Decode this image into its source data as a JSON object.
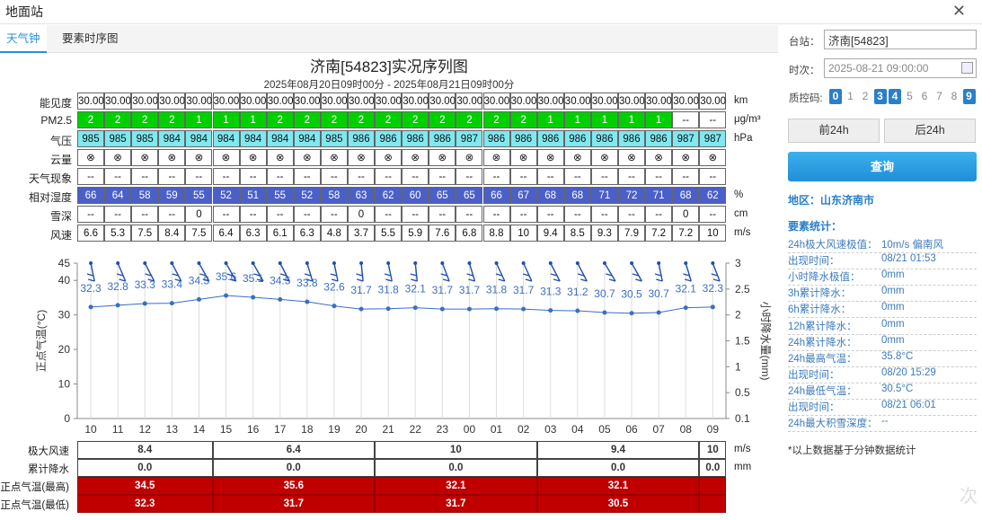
{
  "window": {
    "title": "地面站",
    "close": "✕"
  },
  "tabs": [
    {
      "label": "天气钟",
      "active": true
    },
    {
      "label": "要素时序图",
      "active": false
    }
  ],
  "chart_title": "济南[54823]实况序列图",
  "chart_subtitle": "2025年08月20日09时00分 - 2025年08月21日09时00分",
  "grid_rows": [
    {
      "label": "能见度",
      "unit": "km",
      "color": "#ffffff",
      "text_color": "#111",
      "values": [
        "30.00",
        "30.00",
        "30.00",
        "30.00",
        "30.00",
        "30.00",
        "30.00",
        "30.00",
        "30.00",
        "30.00",
        "30.00",
        "30.00",
        "30.00",
        "30.00",
        "30.00",
        "30.00",
        "30.00",
        "30.00",
        "30.00",
        "30.00",
        "30.00",
        "30.00",
        "30.00",
        "30.00"
      ]
    },
    {
      "label": "PM2.5",
      "unit": "μg/m³",
      "color": "#00d000",
      "text_color": "#fff",
      "values": [
        "2",
        "2",
        "2",
        "2",
        "1",
        "1",
        "1",
        "2",
        "2",
        "2",
        "2",
        "2",
        "2",
        "2",
        "2",
        "2",
        "2",
        "1",
        "1",
        "1",
        "1",
        "1",
        "--",
        "--"
      ]
    },
    {
      "label": "气压",
      "unit": "hPa",
      "color": "#7fe8f0",
      "text_color": "#111",
      "values": [
        "985",
        "985",
        "985",
        "984",
        "984",
        "984",
        "984",
        "984",
        "984",
        "985",
        "986",
        "986",
        "986",
        "986",
        "987",
        "986",
        "986",
        "986",
        "986",
        "986",
        "986",
        "986",
        "987",
        "987"
      ]
    },
    {
      "label": "云量",
      "unit": "",
      "color": "#ffffff",
      "text_color": "#111",
      "values": [
        "⊗",
        "⊗",
        "⊗",
        "⊗",
        "⊗",
        "⊗",
        "⊗",
        "⊗",
        "⊗",
        "⊗",
        "⊗",
        "⊗",
        "⊗",
        "⊗",
        "⊗",
        "⊗",
        "⊗",
        "⊗",
        "⊗",
        "⊗",
        "⊗",
        "⊗",
        "⊗",
        "⊗"
      ]
    },
    {
      "label": "天气现象",
      "unit": "",
      "color": "#ffffff",
      "text_color": "#111",
      "values": [
        "--",
        "--",
        "--",
        "--",
        "--",
        "--",
        "--",
        "--",
        "--",
        "--",
        "--",
        "--",
        "--",
        "--",
        "--",
        "--",
        "--",
        "--",
        "--",
        "--",
        "--",
        "--",
        "--",
        "--"
      ]
    },
    {
      "label": "相对湿度",
      "unit": "%",
      "color": "#4a5fc8",
      "text_color": "#fff",
      "values": [
        "66",
        "64",
        "58",
        "59",
        "55",
        "52",
        "51",
        "55",
        "52",
        "58",
        "63",
        "62",
        "60",
        "65",
        "65",
        "66",
        "67",
        "68",
        "68",
        "71",
        "72",
        "71",
        "68",
        "62"
      ]
    },
    {
      "label": "雪深",
      "unit": "cm",
      "color": "#ffffff",
      "text_color": "#111",
      "values": [
        "--",
        "--",
        "--",
        "--",
        "0",
        "--",
        "--",
        "--",
        "--",
        "--",
        "0",
        "--",
        "--",
        "--",
        "--",
        "--",
        "--",
        "--",
        "--",
        "--",
        "--",
        "--",
        "0",
        "--"
      ]
    },
    {
      "label": "风速",
      "unit": "m/s",
      "color": "#ffffff",
      "text_color": "#111",
      "values": [
        "6.6",
        "5.3",
        "7.5",
        "8.4",
        "7.5",
        "6.4",
        "6.3",
        "6.1",
        "6.3",
        "4.8",
        "3.7",
        "5.5",
        "5.9",
        "7.6",
        "6.8",
        "8.8",
        "10",
        "9.4",
        "8.5",
        "9.3",
        "7.9",
        "7.2",
        "7.2",
        "10"
      ]
    }
  ],
  "chart_data": {
    "type": "line",
    "x": [
      "10",
      "11",
      "12",
      "13",
      "14",
      "15",
      "16",
      "17",
      "18",
      "19",
      "20",
      "21",
      "22",
      "23",
      "00",
      "01",
      "02",
      "03",
      "04",
      "05",
      "06",
      "07",
      "08",
      "09"
    ],
    "series": [
      {
        "values": [
          32.3,
          32.8,
          33.3,
          33.4,
          34.5,
          35.6,
          35.1,
          34.5,
          33.8,
          32.6,
          31.7,
          31.8,
          32.1,
          31.7,
          31.7,
          31.8,
          31.7,
          31.3,
          31.2,
          30.7,
          30.5,
          30.7,
          32.1,
          32.3
        ]
      }
    ],
    "ylabel": "正点气温(°C)",
    "y2label": "小时降水量(mm)",
    "ylim": [
      0,
      45
    ],
    "y_ticks": [
      "0",
      "10",
      "20",
      "30",
      "40",
      "45"
    ],
    "y2_ticks": [
      "0.1",
      "0.5",
      "1",
      "1.5",
      "2",
      "2.5",
      "3"
    ],
    "wind_dir_deg": [
      340,
      315,
      300,
      300,
      290,
      290,
      290,
      300,
      330,
      340,
      350,
      340,
      350,
      320,
      330,
      310,
      310,
      300,
      300,
      270,
      290,
      340,
      330,
      320
    ]
  },
  "bottom_rows": [
    {
      "label": "极大风速",
      "unit": "m/s",
      "style": "plain",
      "values": [
        "8.4",
        "6.4",
        "10",
        "9.4",
        "10"
      ]
    },
    {
      "label": "累计降水",
      "unit": "mm",
      "style": "plain",
      "values": [
        "0.0",
        "0.0",
        "0.0",
        "0.0",
        "0.0"
      ]
    },
    {
      "label": "正点气温(最高)",
      "unit": "",
      "style": "red",
      "values": [
        "34.5",
        "35.6",
        "32.1",
        "32.1",
        ""
      ]
    },
    {
      "label": "正点气温(最低)",
      "unit": "",
      "style": "red",
      "values": [
        "32.3",
        "31.7",
        "31.7",
        "30.5",
        ""
      ]
    }
  ],
  "sidebar": {
    "station_label": "台站：",
    "station_value": "济南[54823]",
    "time_label": "时次：",
    "time_value": "2025-08-21 09:00:00",
    "qc_label": "质控码:",
    "qc_codes": [
      {
        "v": "0",
        "on": true
      },
      {
        "v": "1",
        "on": false
      },
      {
        "v": "2",
        "on": false
      },
      {
        "v": "3",
        "on": true
      },
      {
        "v": "4",
        "on": true
      },
      {
        "v": "5",
        "on": false
      },
      {
        "v": "6",
        "on": false
      },
      {
        "v": "7",
        "on": false
      },
      {
        "v": "8",
        "on": false
      },
      {
        "v": "9",
        "on": true
      }
    ],
    "prev_label": "前24h",
    "next_label": "后24h",
    "query_label": "查询",
    "region": "地区：山东济南市",
    "stats_title": "要素统计：",
    "stats": [
      {
        "k": "24h极大风速极值：",
        "v": "10m/s 偏南风"
      },
      {
        "k": "出现时间：",
        "v": "08/21 01:53"
      },
      {
        "k": "小时降水极值：",
        "v": "0mm"
      },
      {
        "k": "3h累计降水：",
        "v": "0mm"
      },
      {
        "k": "6h累计降水：",
        "v": "0mm"
      },
      {
        "k": "12h累计降水：",
        "v": "0mm"
      },
      {
        "k": "24h累计降水：",
        "v": "0mm"
      },
      {
        "k": "24h最高气温：",
        "v": "35.8°C"
      },
      {
        "k": "出现时间：",
        "v": "08/20 15:29"
      },
      {
        "k": "24h最低气温：",
        "v": "30.5°C"
      },
      {
        "k": "出现时间：",
        "v": "08/21 06:01"
      },
      {
        "k": "24h最大积雪深度：",
        "v": "--"
      }
    ],
    "footnote": "*以上数据基于分钟数据统计"
  },
  "watermark": "次"
}
